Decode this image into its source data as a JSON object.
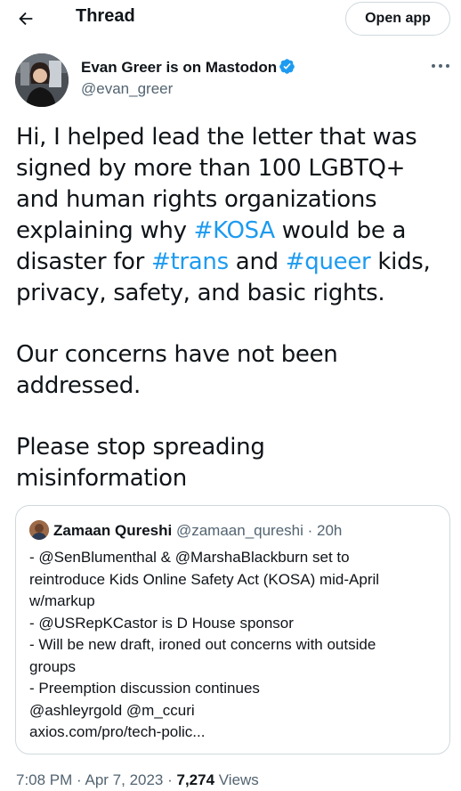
{
  "header": {
    "title": "Thread",
    "open_app_label": "Open app"
  },
  "author": {
    "display_name": "Evan Greer is on Mastodon",
    "handle": "@evan_greer"
  },
  "tweet": {
    "paragraph1": [
      [
        {
          "t": "Hi, I helped lead the letter that was"
        }
      ],
      [
        {
          "t": "signed by more than 100 LGBTQ+"
        }
      ],
      [
        {
          "t": "and human rights organizations"
        }
      ],
      [
        {
          "t": "explaining why "
        },
        {
          "t": "#KOSA",
          "h": true
        },
        {
          "t": " would be a"
        }
      ],
      [
        {
          "t": "disaster for "
        },
        {
          "t": "#trans",
          "h": true
        },
        {
          "t": " and "
        },
        {
          "t": "#queer",
          "h": true
        },
        {
          "t": " kids,"
        }
      ],
      [
        {
          "t": "privacy, safety, and basic rights."
        }
      ]
    ],
    "paragraph2": [
      "Our concerns have not been",
      "addressed."
    ],
    "paragraph3": [
      "Please stop spreading",
      "misinformation"
    ]
  },
  "quote": {
    "name": "Zamaan Qureshi",
    "handle": "@zamaan_qureshi",
    "separator": " · ",
    "time": "20h",
    "lines": [
      "- @SenBlumenthal & @MarshaBlackburn set to",
      "reintroduce Kids Online Safety Act (KOSA) mid-April",
      "w/markup",
      "- @USRepKCastor is D House sponsor",
      "- Will be new draft, ironed out concerns with outside",
      "groups",
      "- Preemption discussion continues",
      "@ashleyrgold @m_ccuri",
      "axios.com/pro/tech-polic..."
    ]
  },
  "footer": {
    "time": "7:08 PM",
    "separator": " · ",
    "date": "Apr 7, 2023",
    "views_count": "7,274",
    "views_label": " Views"
  },
  "colors": {
    "accent": "#1d9bf0",
    "text": "#0f1419",
    "muted": "#536471",
    "border": "#cfd9de"
  }
}
